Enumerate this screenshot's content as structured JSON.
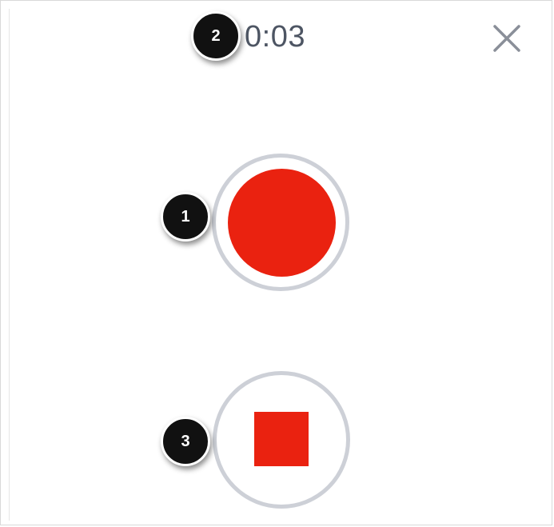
{
  "recorder": {
    "elapsed_time": "0:03",
    "close_icon": "close-icon",
    "record_icon": "record-icon",
    "stop_icon": "stop-icon"
  },
  "callouts": {
    "record": "1",
    "timer": "2",
    "stop": "3"
  },
  "colors": {
    "record_red": "#ea2210",
    "ring_gray": "#cdd0d7",
    "timer_text": "#4d5563",
    "close_icon": "#8a8f99",
    "callout_bg": "#111111"
  }
}
